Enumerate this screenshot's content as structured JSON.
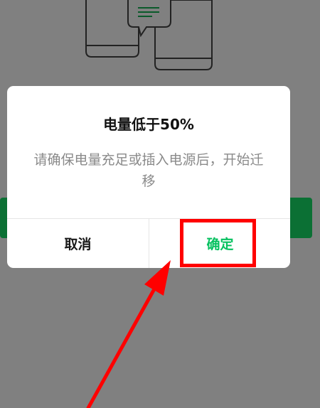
{
  "dialog": {
    "title": "电量低于50%",
    "message": "请确保电量充足或插入电源后，开始迁移",
    "cancel_label": "取消",
    "confirm_label": "确定"
  },
  "colors": {
    "overlay_bg": "#808080",
    "confirm_text": "#07c160",
    "background_button": "#0b7034",
    "highlight": "#ff0000"
  },
  "icons": {
    "illustration": "phone-transfer-illustration-icon",
    "annotation": "red-arrow-annotation"
  }
}
